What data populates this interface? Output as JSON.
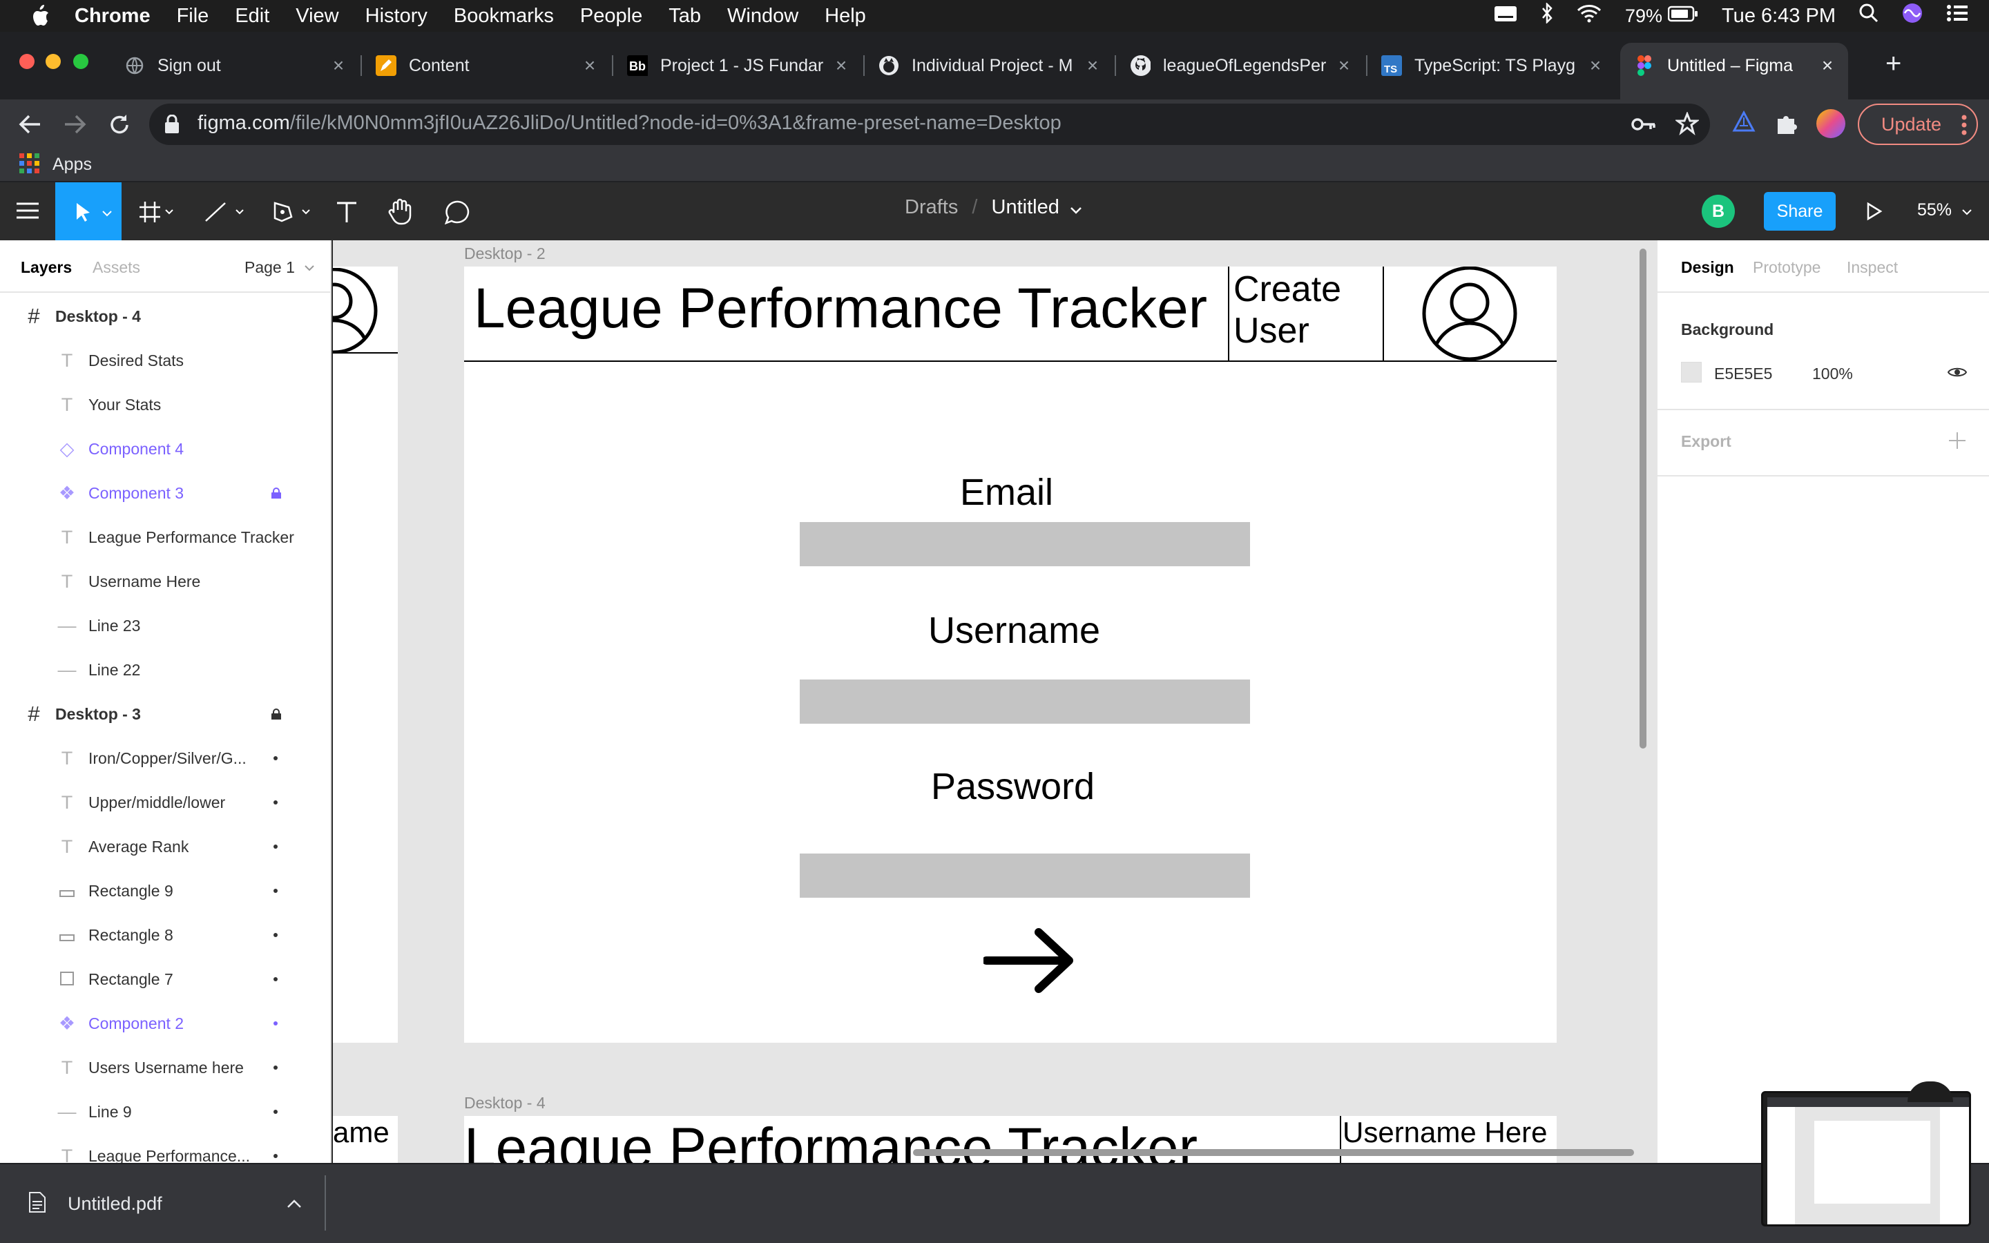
{
  "menubar": {
    "app": "Chrome",
    "items": [
      "File",
      "Edit",
      "View",
      "History",
      "Bookmarks",
      "People",
      "Tab",
      "Window",
      "Help"
    ],
    "battery": "79%",
    "clock": "Tue 6:43 PM"
  },
  "tabs": [
    {
      "label": "Sign out",
      "icon": "globe-icon"
    },
    {
      "label": "Content",
      "icon": "pencil-icon"
    },
    {
      "label": "Project 1 - JS Fundar",
      "icon": "blackboard-icon"
    },
    {
      "label": "Individual Project - M",
      "icon": "kitten-icon"
    },
    {
      "label": "leagueOfLegendsPer",
      "icon": "github-icon"
    },
    {
      "label": "TypeScript: TS Playg",
      "icon": "typescript-icon"
    },
    {
      "label": "Untitled – Figma",
      "icon": "figma-icon",
      "active": true
    }
  ],
  "address": {
    "host": "figma.com",
    "path": "/file/kM0N0mm3jfI0uAZ26JliDo/Untitled?node-id=0%3A1&frame-preset-name=Desktop",
    "update_label": "Update"
  },
  "bookmarks": {
    "apps": "Apps"
  },
  "figma": {
    "breadcrumb_parent": "Drafts",
    "breadcrumb_sep": "/",
    "file_name": "Untitled",
    "avatar": "B",
    "share": "Share",
    "zoom": "55%"
  },
  "left_panel": {
    "tab_layers": "Layers",
    "tab_assets": "Assets",
    "page": "Page 1",
    "layers": [
      {
        "name": "Desktop - 4",
        "kind": "frame"
      },
      {
        "name": "Desired Stats",
        "kind": "text"
      },
      {
        "name": "Your Stats",
        "kind": "text"
      },
      {
        "name": "Component 4",
        "kind": "instance"
      },
      {
        "name": "Component 3",
        "kind": "component",
        "locked": true
      },
      {
        "name": "League Performance Tracker",
        "kind": "text"
      },
      {
        "name": "Username Here",
        "kind": "text"
      },
      {
        "name": "Line 23",
        "kind": "line"
      },
      {
        "name": "Line 22",
        "kind": "line"
      },
      {
        "name": "Desktop - 3",
        "kind": "frame",
        "locked": true
      },
      {
        "name": "Iron/Copper/Silver/G...",
        "kind": "text",
        "dot": true
      },
      {
        "name": "Upper/middle/lower",
        "kind": "text",
        "dot": true
      },
      {
        "name": "Average Rank",
        "kind": "text",
        "dot": true
      },
      {
        "name": "Rectangle 9",
        "kind": "rect-wide",
        "dot": true
      },
      {
        "name": "Rectangle 8",
        "kind": "rect-wide",
        "dot": true
      },
      {
        "name": "Rectangle 7",
        "kind": "rect",
        "dot": true
      },
      {
        "name": "Component 2",
        "kind": "component",
        "dot": true
      },
      {
        "name": "Users Username here",
        "kind": "text",
        "dot": true
      },
      {
        "name": "Line 9",
        "kind": "line",
        "dot": true
      },
      {
        "name": "League Performance...",
        "kind": "text",
        "dot": true
      }
    ]
  },
  "canvas": {
    "frame2_label": "Desktop - 2",
    "frame4_label": "Desktop - 4",
    "title": "League Performance Tracker",
    "create_user_line1": "Create",
    "create_user_line2": "User",
    "email": "Email",
    "username": "Username",
    "password": "Password",
    "frame4_title": "League Performance Tracker",
    "frame4_username": "Username Here",
    "left_partial": "ame"
  },
  "right_panel": {
    "tab_design": "Design",
    "tab_prototype": "Prototype",
    "tab_inspect": "Inspect",
    "background_heading": "Background",
    "bg_hex": "E5E5E5",
    "bg_opacity": "100%",
    "export_heading": "Export",
    "bg_color": "#e5e5e5"
  },
  "downloads": {
    "file": "Untitled.pdf"
  }
}
